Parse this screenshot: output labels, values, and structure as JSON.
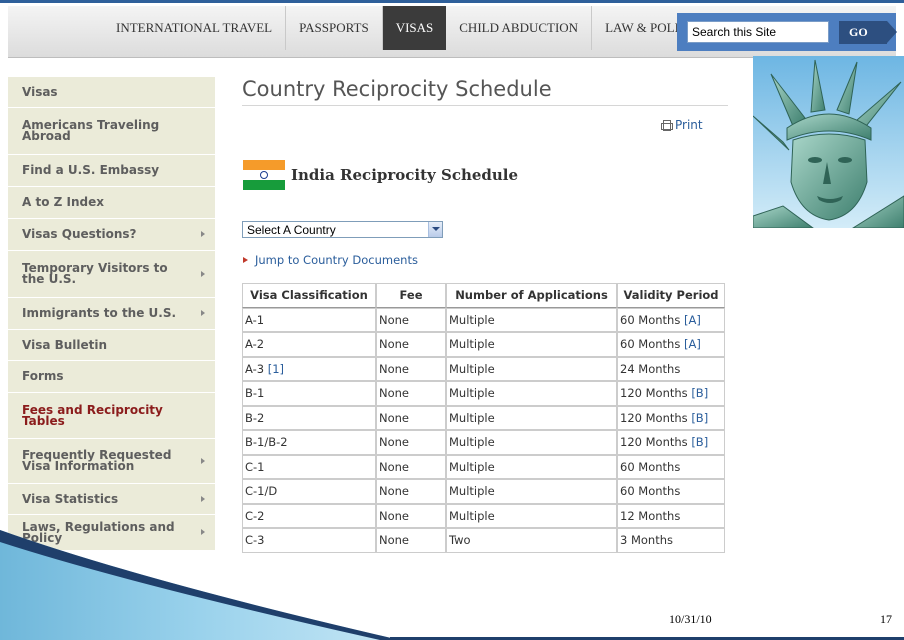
{
  "nav": {
    "items": [
      "INTERNATIONAL TRAVEL",
      "PASSPORTS",
      "VISAS",
      "CHILD ABDUCTION",
      "LAW & POLICY"
    ],
    "active_index": 2,
    "search_placeholder": "Search this Site",
    "search_button": "GO"
  },
  "sidebar": {
    "items": [
      {
        "label": "Visas",
        "lines": [
          "Visas"
        ],
        "arrow": false
      },
      {
        "label": "Americans Traveling Abroad",
        "lines": [
          "Americans Traveling",
          "Abroad"
        ],
        "arrow": false
      },
      {
        "label": "Find a U.S. Embassy",
        "lines": [
          "Find a U.S. Embassy"
        ],
        "arrow": false
      },
      {
        "label": "A to Z Index",
        "lines": [
          "A to Z Index"
        ],
        "arrow": false
      },
      {
        "label": "Visas Questions?",
        "lines": [
          "Visas Questions?"
        ],
        "arrow": true
      },
      {
        "label": "Temporary Visitors to the U.S.",
        "lines": [
          "Temporary Visitors to",
          "the U.S."
        ],
        "arrow": true
      },
      {
        "label": "Immigrants to the U.S.",
        "lines": [
          "Immigrants to the U.S."
        ],
        "arrow": true
      },
      {
        "label": "Visa Bulletin",
        "lines": [
          "Visa Bulletin"
        ],
        "arrow": false
      },
      {
        "label": "Forms",
        "lines": [
          "Forms"
        ],
        "arrow": false
      },
      {
        "label": "Fees and Reciprocity Tables",
        "lines": [
          "Fees and Reciprocity",
          "Tables"
        ],
        "arrow": false,
        "active": true
      },
      {
        "label": "Frequently Requested Visa Information",
        "lines": [
          "Frequently Requested",
          "Visa Information"
        ],
        "arrow": true
      },
      {
        "label": "Visa Statistics",
        "lines": [
          "Visa Statistics"
        ],
        "arrow": true
      },
      {
        "label": "Laws, Regulations and Policy",
        "lines": [
          "Laws, Regulations and",
          "Policy"
        ],
        "arrow": true
      }
    ]
  },
  "main": {
    "title": "Country Reciprocity Schedule",
    "print_label": "Print",
    "subtitle": "India Reciprocity Schedule",
    "country_select": "Select A Country",
    "jump_link": "Jump to Country Documents"
  },
  "table": {
    "headers": [
      "Visa Classification",
      "Fee",
      "Number of Applications",
      "Validity Period"
    ],
    "rows": [
      {
        "cls": "A-1",
        "cls_ref": "",
        "fee": "None",
        "apps": "Multiple",
        "validity": "60 Months",
        "validity_ref": "[A]"
      },
      {
        "cls": "A-2",
        "cls_ref": "",
        "fee": "None",
        "apps": "Multiple",
        "validity": "60 Months",
        "validity_ref": "[A]"
      },
      {
        "cls": "A-3",
        "cls_ref": "[1]",
        "fee": "None",
        "apps": "Multiple",
        "validity": "24 Months",
        "validity_ref": ""
      },
      {
        "cls": "B-1",
        "cls_ref": "",
        "fee": "None",
        "apps": "Multiple",
        "validity": "120 Months",
        "validity_ref": "[B]"
      },
      {
        "cls": "B-2",
        "cls_ref": "",
        "fee": "None",
        "apps": "Multiple",
        "validity": "120 Months",
        "validity_ref": "[B]"
      },
      {
        "cls": "B-1/B-2",
        "cls_ref": "",
        "fee": "None",
        "apps": "Multiple",
        "validity": "120 Months",
        "validity_ref": "[B]"
      },
      {
        "cls": "C-1",
        "cls_ref": "",
        "fee": "None",
        "apps": "Multiple",
        "validity": "60 Months",
        "validity_ref": ""
      },
      {
        "cls": "C-1/D",
        "cls_ref": "",
        "fee": "None",
        "apps": "Multiple",
        "validity": "60 Months",
        "validity_ref": ""
      },
      {
        "cls": "C-2",
        "cls_ref": "",
        "fee": "None",
        "apps": "Multiple",
        "validity": "12 Months",
        "validity_ref": ""
      },
      {
        "cls": "C-3",
        "cls_ref": "",
        "fee": "None",
        "apps": "Two",
        "validity": "3 Months",
        "validity_ref": ""
      }
    ]
  },
  "footer": {
    "date": "10/31/10",
    "page": "17"
  },
  "colors": {
    "link": "#2a5d9b",
    "active_sidebar": "#8b1c1c",
    "sidebar_bg": "#ebebd9",
    "search_bg": "#4d7ec0"
  }
}
